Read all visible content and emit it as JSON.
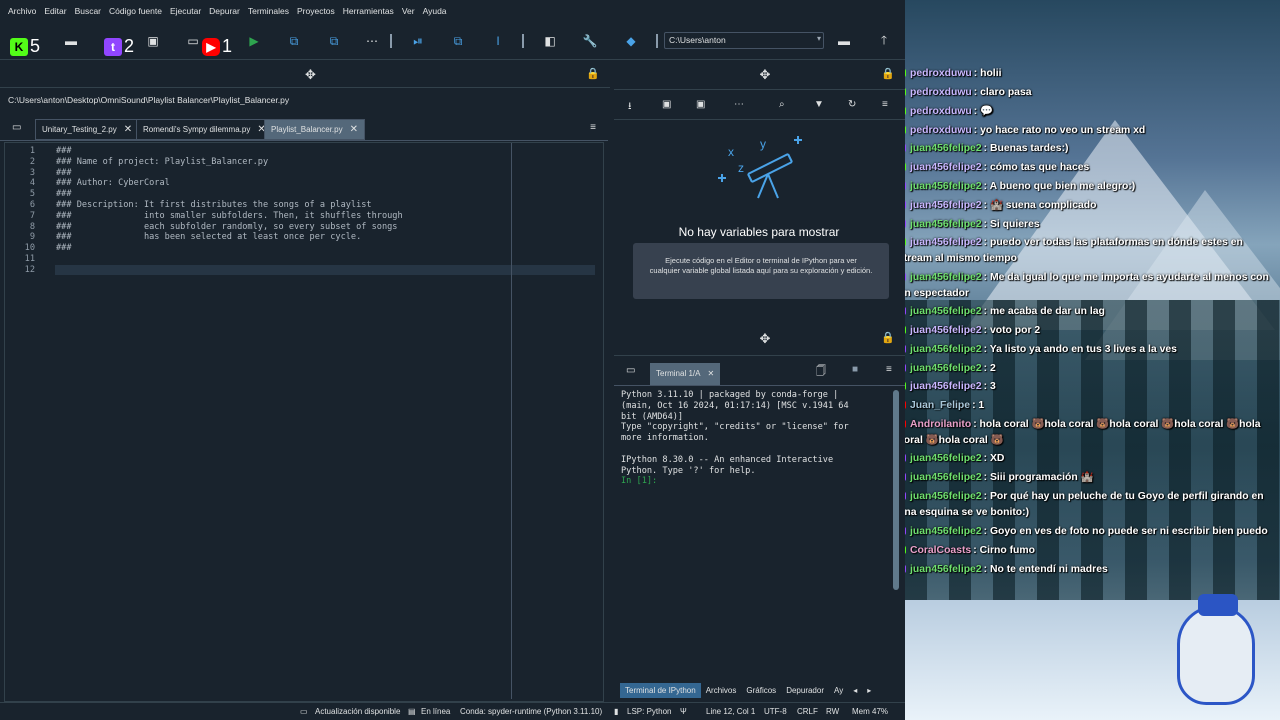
{
  "menu": [
    "Archivo",
    "Editar",
    "Buscar",
    "Código fuente",
    "Ejecutar",
    "Depurar",
    "Terminales",
    "Proyectos",
    "Herramientas",
    "Ver",
    "Ayuda"
  ],
  "toolbar": {
    "path": "C:\\Users\\anton",
    "counts": {
      "kick": "5",
      "twitch": "2",
      "youtube": "1"
    }
  },
  "editor": {
    "path": "C:\\Users\\anton\\Desktop\\OmniSound\\Playlist Balancer\\Playlist_Balancer.py",
    "tabs": [
      "Unitary_Testing_2.py",
      "Romendi's Sympy dilemma.py",
      "Playlist_Balancer.py"
    ],
    "line_numbers": "1\n2\n3\n4\n5\n6\n7\n8\n9\n10\n11\n12",
    "code": "###\n### Name of project: Playlist_Balancer.py\n###\n### Author: CyberCoral\n###\n### Description: It first distributes the songs of a playlist\n###              into smaller subfolders. Then, it shuffles through\n###              each subfolder randomly, so every subset of songs\n###              has been selected at least once per cycle.\n###\n\n"
  },
  "variables": {
    "empty_title": "No hay variables para mostrar",
    "empty_desc": "Ejecute código en el Editor o terminal de IPython para ver cualquier variable global listada aquí para su exploración y edición."
  },
  "console": {
    "tab": "Terminal 1/A",
    "output": "Python 3.11.10 | packaged by conda-forge |\n(main, Oct 16 2024, 01:17:14) [MSC v.1941 64\nbit (AMD64)]\nType \"copyright\", \"credits\" or \"license\" for\nmore information.\n\nIPython 8.30.0 -- An enhanced Interactive\nPython. Type '?' for help.\n",
    "prompt": "In [1]:",
    "bottom_tabs": [
      "Terminal de IPython",
      "Archivos",
      "Gráficos",
      "Depurador",
      "Ay"
    ]
  },
  "status": {
    "update": "Actualización disponible",
    "online": "En línea",
    "conda": "Conda: spyder-runtime (Python 3.11.10)",
    "lsp": "LSP: Python",
    "pos": "Line 12, Col 1",
    "enc": "UTF-8",
    "eol": "CRLF",
    "rw": "RW",
    "mem": "Mem 47%"
  },
  "chat": [
    {
      "user": "pedroxduwu",
      "text": ": holii",
      "platform": "kick",
      "color": "#c9b7ff"
    },
    {
      "user": "pedroxduwu",
      "text": ": claro pasa",
      "platform": "kick",
      "color": "#c9b7ff"
    },
    {
      "user": "pedroxduwu",
      "text": ": 💬",
      "platform": "kick",
      "color": "#c9b7ff"
    },
    {
      "user": "pedroxduwu",
      "text": ": yo hace rato no veo un stream xd",
      "platform": "kick",
      "color": "#c9b7ff"
    },
    {
      "user": "juan456felipe2",
      "text": ": Buenas tardes:)",
      "platform": "twitch",
      "color": "#6fe06f"
    },
    {
      "user": "juan456felipe2",
      "text": ": cómo tas que haces",
      "platform": "kick",
      "color": "#c9b7ff"
    },
    {
      "user": "juan456felipe2",
      "text": ": A bueno que bien me alegro:)",
      "platform": "twitch",
      "color": "#6fe06f"
    },
    {
      "user": "juan456felipe2",
      "text": ": 🏰 suena complicado",
      "platform": "twitch",
      "color": "#c9b7ff"
    },
    {
      "user": "juan456felipe2",
      "text": ": Si quieres",
      "platform": "twitch",
      "color": "#6fe06f"
    },
    {
      "user": "juan456felipe2",
      "text": ": puedo ver todas las plataformas en dónde estes en stream al mismo tiempo",
      "platform": "kick",
      "color": "#c9b7ff"
    },
    {
      "user": "juan456felipe2",
      "text": ": Me da igual lo que me importa es ayudarte al menos con un espectador",
      "platform": "twitch",
      "color": "#6fe06f"
    },
    {
      "user": "juan456felipe2",
      "text": ": me acaba de dar un lag",
      "platform": "twitch",
      "color": "#6fe06f"
    },
    {
      "user": "juan456felipe2",
      "text": ": voto por 2",
      "platform": "kick",
      "color": "#c9b7ff"
    },
    {
      "user": "juan456felipe2",
      "text": ": Ya listo ya ando en tus 3 lives a la ves",
      "platform": "twitch",
      "color": "#6fe06f"
    },
    {
      "user": "juan456felipe2",
      "text": ": 2",
      "platform": "twitch",
      "color": "#6fe06f"
    },
    {
      "user": "juan456felipe2",
      "text": ": 3",
      "platform": "kick",
      "color": "#c9b7ff"
    },
    {
      "user": "Juan_Felipe",
      "text": ": 1",
      "platform": "youtube",
      "color": "#a9c7d9"
    },
    {
      "user": "Androilanito",
      "text": ": hola coral 🐻hola coral 🐻hola coral 🐻hola coral 🐻hola coral 🐻hola coral 🐻",
      "platform": "youtube",
      "color": "#e8a0c9"
    },
    {
      "user": "juan456felipe2",
      "text": ": XD",
      "platform": "twitch",
      "color": "#6fe06f"
    },
    {
      "user": "juan456felipe2",
      "text": ": Siii programación 🏰",
      "platform": "twitch",
      "color": "#6fe06f"
    },
    {
      "user": "juan456felipe2",
      "text": ": Por qué hay un peluche de tu Goyo de perfil girando en una esquina se ve bonito:)",
      "platform": "twitch",
      "color": "#6fe06f"
    },
    {
      "user": "juan456felipe2",
      "text": ": Goyo en ves de foto no puede ser ni escribir bien puedo",
      "platform": "twitch",
      "color": "#6fe06f"
    },
    {
      "user": "CoralCoasts",
      "text": ": Cirno fumo",
      "platform": "kick",
      "color": "#e8a0c9"
    },
    {
      "user": "juan456felipe2",
      "text": ": No te entendí ni madres",
      "platform": "twitch",
      "color": "#6fe06f"
    }
  ],
  "colors": {
    "bg": "#19232d",
    "accent": "#346792",
    "kick": "#53fc18",
    "twitch": "#9146ff",
    "youtube": "#ff0000"
  }
}
